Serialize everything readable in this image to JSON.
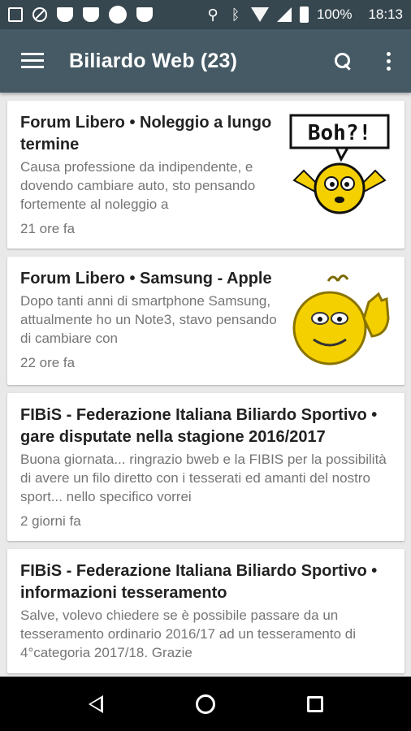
{
  "status_bar": {
    "battery": "100%",
    "time": "18:13"
  },
  "app_bar": {
    "title": "Biliardo Web (23)"
  },
  "posts": [
    {
      "title": "Forum Libero • Noleggio a lungo termine",
      "excerpt": "Causa professione da indipendente, e dovendo cambiare auto, sto pensando fortemente al noleggio a",
      "time": "21 ore fa",
      "thumb_text": "Boh?!"
    },
    {
      "title": "Forum Libero • Samsung - Apple",
      "excerpt": "Dopo tanti anni di smartphone Samsung, attualmente ho un Note3, stavo pensando di cambiare con",
      "time": "22 ore fa"
    },
    {
      "title": "FIBiS - Federazione Italiana Biliardo Sportivo • gare disputate nella stagione 2016/2017",
      "excerpt": "Buona giornata... ringrazio bweb e la FIBIS per la possibilità di avere un filo diretto con i tesserati ed amanti del nostro sport... nello specifico vorrei",
      "time": "2 giorni fa"
    },
    {
      "title": "FIBiS - Federazione Italiana Biliardo Sportivo • informazioni tesseramento",
      "excerpt": "Salve, volevo chiedere se è possibile passare da un tesseramento ordinario 2016/17 ad un tesseramento di 4°categoria 2017/18. Grazie"
    }
  ],
  "colors": {
    "status_bar": "#37474f",
    "app_bar": "#455a64",
    "background": "#e9e9e9",
    "smiley": "#f5d000"
  },
  "icons": [
    "image-icon",
    "block-icon",
    "shield-icon",
    "notification-icon",
    "usb-icon",
    "bluetooth-icon",
    "wifi-icon",
    "signal-icon",
    "battery-icon",
    "menu-icon",
    "search-icon",
    "more-vert-icon",
    "back-icon",
    "home-icon",
    "recents-icon"
  ]
}
